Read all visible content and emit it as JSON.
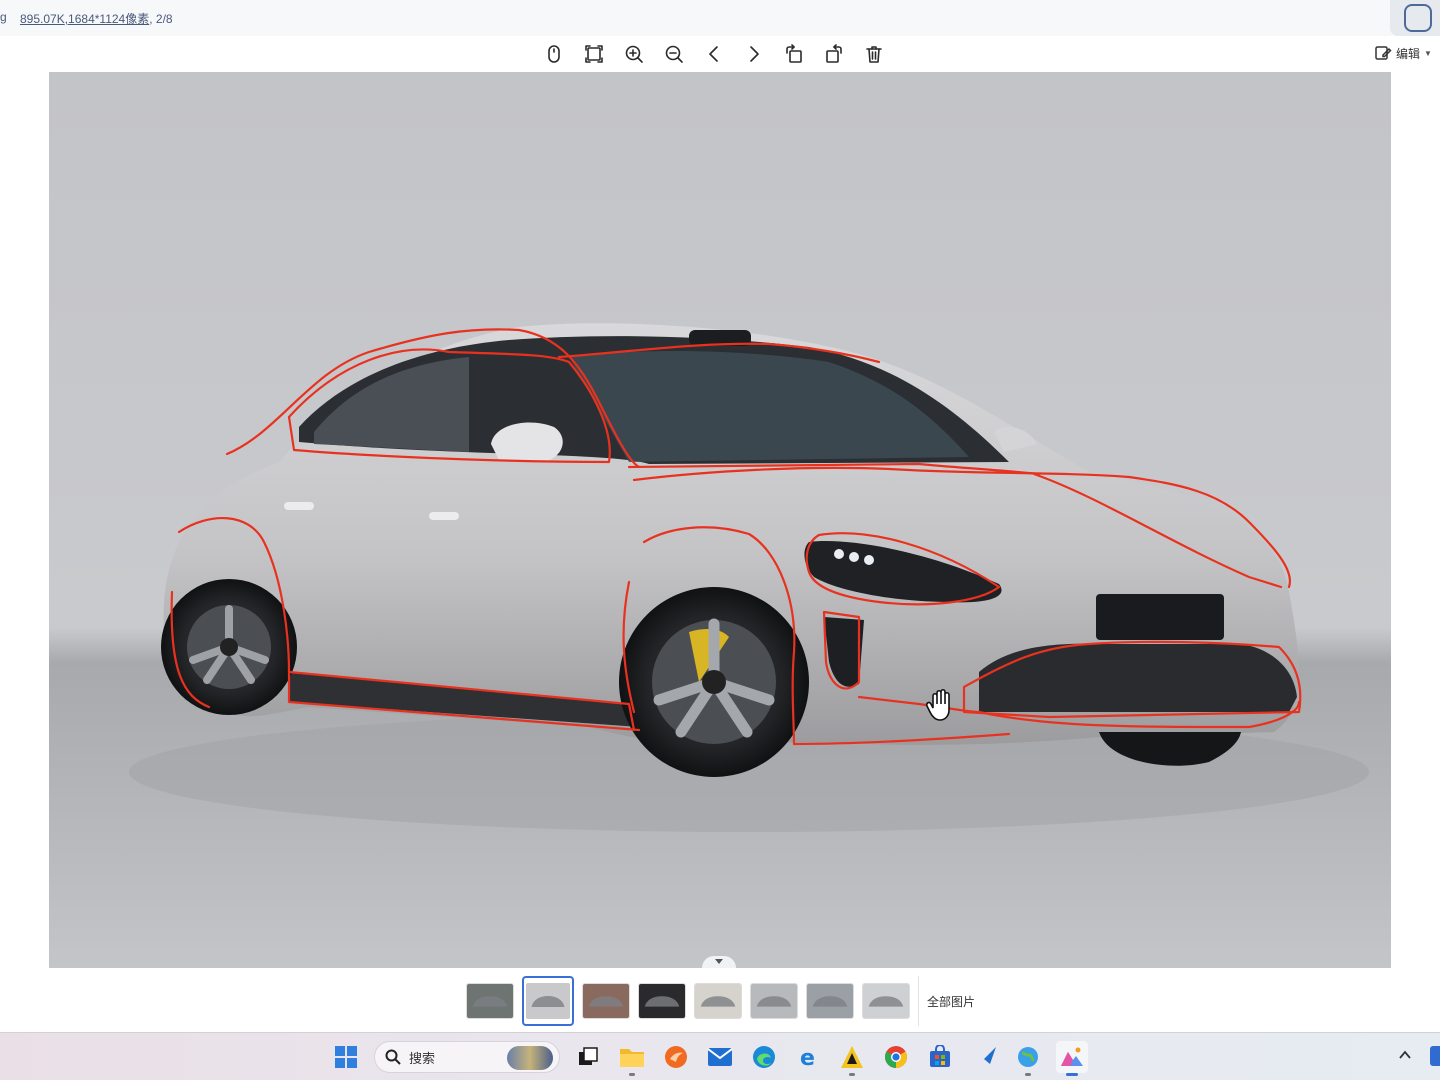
{
  "info": {
    "prefix": "g",
    "file_size": "895.07K",
    "dimensions": ",1684*1124像素",
    "position": ", 2/8"
  },
  "toolbar": {
    "tools": [
      {
        "name": "mouse-mode",
        "icon": "mouse-icon"
      },
      {
        "name": "fit-screen",
        "icon": "fit-screen-icon"
      },
      {
        "name": "zoom-in",
        "icon": "zoom-in-icon"
      },
      {
        "name": "zoom-out",
        "icon": "zoom-out-icon"
      },
      {
        "name": "previous",
        "icon": "chevron-left-icon"
      },
      {
        "name": "next",
        "icon": "chevron-right-icon"
      },
      {
        "name": "rotate-left",
        "icon": "rotate-left-icon"
      },
      {
        "name": "rotate-right",
        "icon": "rotate-right-icon"
      },
      {
        "name": "delete",
        "icon": "trash-icon"
      }
    ],
    "edit_label": "编辑"
  },
  "filmstrip": {
    "thumbnails": [
      {
        "index": 1,
        "tone": "#6e7472"
      },
      {
        "index": 2,
        "tone": "#c9c9cc",
        "active": true
      },
      {
        "index": 3,
        "tone": "#8a6a5e"
      },
      {
        "index": 4,
        "tone": "#2a2a2c"
      },
      {
        "index": 5,
        "tone": "#d6d2cc"
      },
      {
        "index": 6,
        "tone": "#b8b9bd"
      },
      {
        "index": 7,
        "tone": "#9aa0a6"
      },
      {
        "index": 8,
        "tone": "#cfd0d3"
      }
    ],
    "all_images_label": "全部图片"
  },
  "taskbar": {
    "search_label": "搜索",
    "apps": [
      {
        "name": "start",
        "icon": "windows-start-icon"
      },
      {
        "name": "task-view",
        "icon": "task-view-icon"
      },
      {
        "name": "file-explorer",
        "icon": "folder-icon",
        "running": true
      },
      {
        "name": "app-orange",
        "icon": "orange-app-icon"
      },
      {
        "name": "mail",
        "icon": "mail-icon"
      },
      {
        "name": "edge",
        "icon": "edge-icon"
      },
      {
        "name": "ie",
        "icon": "ie-icon"
      },
      {
        "name": "app-yellow",
        "icon": "yellow-a-icon",
        "running": true
      },
      {
        "name": "chrome",
        "icon": "chrome-icon"
      },
      {
        "name": "store",
        "icon": "store-icon"
      },
      {
        "name": "app-bird",
        "icon": "bird-app-icon"
      },
      {
        "name": "app-globe",
        "icon": "globe-app-icon",
        "running": true
      },
      {
        "name": "photo-viewer",
        "icon": "photo-viewer-icon",
        "active": true
      }
    ]
  },
  "colors": {
    "accent": "#3a6fd8",
    "annotation_stroke": "#e8321f",
    "car_body": "#c8c8ca"
  }
}
